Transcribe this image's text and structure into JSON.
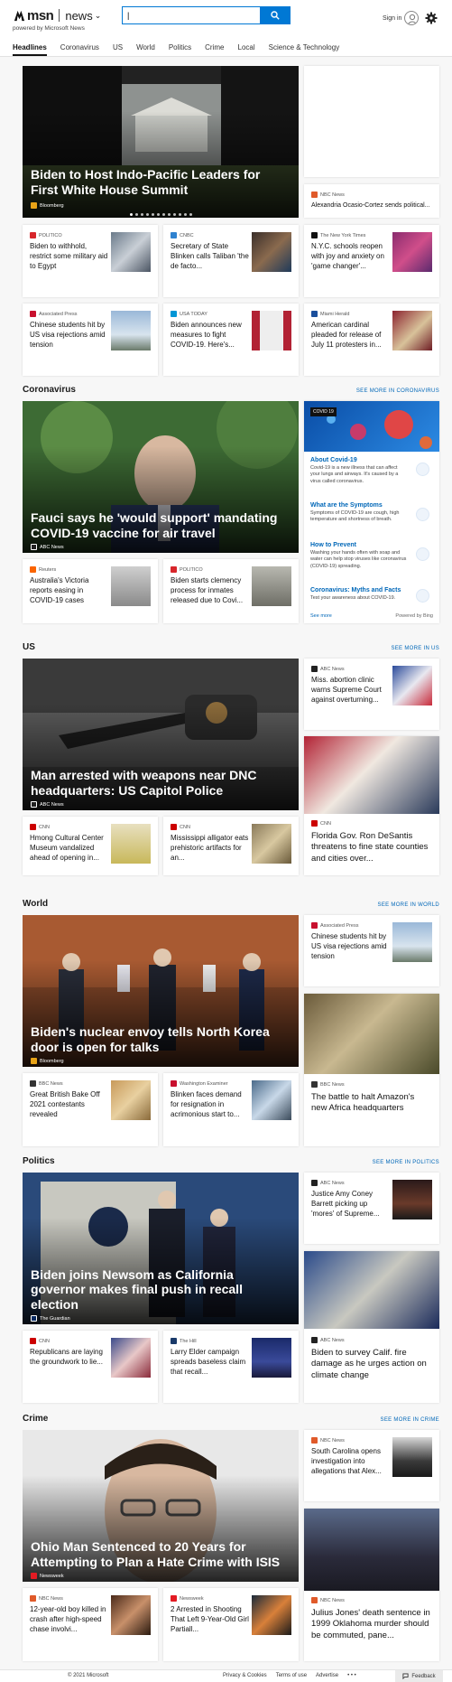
{
  "header": {
    "logo_text": "msn",
    "news_label": "news",
    "powered_by": "powered by Microsoft News",
    "search_value": "|",
    "sign_in": "Sign in"
  },
  "tabs": [
    "Headlines",
    "Coronavirus",
    "US",
    "World",
    "Politics",
    "Crime",
    "Local",
    "Science & Technology"
  ],
  "headlines": {
    "hero": {
      "title": "Biden to Host Indo-Pacific Leaders for First White House Summit",
      "source": "Bloomberg"
    },
    "side1": {
      "source": "NBC News",
      "title": "Alexandria Ocasio-Cortez sends political..."
    },
    "row1": [
      {
        "source": "POLITICO",
        "title": "Biden to withhold, restrict some military aid to Egypt"
      },
      {
        "source": "CNBC",
        "title": "Secretary of State Blinken calls Taliban 'the de facto..."
      },
      {
        "source": "The New York Times",
        "title": "N.Y.C. schools reopen with joy and anxiety on 'game changer'..."
      }
    ],
    "row2": [
      {
        "source": "Associated Press",
        "title": "Chinese students hit by US visa rejections amid tension"
      },
      {
        "source": "USA TODAY",
        "title": "Biden announces new measures to fight COVID-19. Here's..."
      },
      {
        "source": "Miami Herald",
        "title": "American cardinal pleaded for release of July 11 protesters in..."
      }
    ]
  },
  "coronavirus": {
    "title": "Coronavirus",
    "see_more": "SEE MORE IN CORONAVIRUS",
    "hero": {
      "title": "Fauci says he 'would support' mandating COVID-19 vaccine for air travel",
      "source": "ABC News"
    },
    "row": [
      {
        "source": "Reuters",
        "title": "Australia's Victoria reports easing in COVID-19 cases"
      },
      {
        "source": "POLITICO",
        "title": "Biden starts clemency process for inmates released due to Covi..."
      }
    ],
    "panel": {
      "tag": "COVID 19",
      "items": [
        {
          "title": "About Covid-19",
          "desc": "Covid-19 is a new illness that can affect your lungs and airways. It's caused by a virus called coronavirus."
        },
        {
          "title": "What are the Symptoms",
          "desc": "Symptoms of COVID-19 are cough, high temperature and shortness of breath."
        },
        {
          "title": "How to Prevent",
          "desc": "Washing your hands often with soap and water can help stop viruses like coronavirus (COVID-19) spreading."
        },
        {
          "title": "Coronavirus: Myths and Facts",
          "desc": "Test your awareness about COVID-19."
        }
      ],
      "see_more": "See more",
      "powered": "Powered by Bing"
    }
  },
  "us": {
    "title": "US",
    "see_more": "SEE MORE IN US",
    "hero": {
      "title": "Man arrested with weapons near DNC headquarters: US Capitol Police",
      "source": "ABC News"
    },
    "side1": {
      "source": "ABC News",
      "title": "Miss. abortion clinic warns Supreme Court against overturning..."
    },
    "row": [
      {
        "source": "CNN",
        "title": "Hmong Cultural Center Museum vandalized ahead of opening in..."
      },
      {
        "source": "CNN",
        "title": "Mississippi alligator eats prehistoric artifacts for an..."
      }
    ],
    "side2": {
      "source": "CNN",
      "title": "Florida Gov. Ron DeSantis threatens to fine state counties and cities over..."
    }
  },
  "world": {
    "title": "World",
    "see_more": "SEE MORE IN WORLD",
    "hero": {
      "title": "Biden's nuclear envoy tells North Korea door is open for talks",
      "source": "Bloomberg"
    },
    "side1": {
      "source": "Associated Press",
      "title": "Chinese students hit by US visa rejections amid tension"
    },
    "row": [
      {
        "source": "BBC News",
        "title": "Great British Bake Off 2021 contestants revealed"
      },
      {
        "source": "Washington Examiner",
        "title": "Blinken faces demand for resignation in acrimonious start to..."
      }
    ],
    "side2": {
      "source": "BBC News",
      "title": "The battle to halt Amazon's new Africa headquarters"
    }
  },
  "politics": {
    "title": "Politics",
    "see_more": "SEE MORE IN POLITICS",
    "hero": {
      "title": "Biden joins Newsom as California governor makes final push in recall election",
      "source": "The Guardian"
    },
    "side1": {
      "source": "ABC News",
      "title": "Justice Amy Coney Barrett picking up 'mores' of Supreme..."
    },
    "row": [
      {
        "source": "CNN",
        "title": "Republicans are laying the groundwork to lie..."
      },
      {
        "source": "The Hill",
        "title": "Larry Elder campaign spreads baseless claim that recall..."
      }
    ],
    "side2": {
      "source": "ABC News",
      "title": "Biden to survey Calif. fire damage as he urges action on climate change"
    }
  },
  "crime": {
    "title": "Crime",
    "see_more": "SEE MORE IN CRIME",
    "hero": {
      "title": "Ohio Man Sentenced to 20 Years for Attempting to Plan a Hate Crime with ISIS",
      "source": "Newsweek"
    },
    "side1": {
      "source": "NBC News",
      "title": "South Carolina opens investigation into allegations that Alex..."
    },
    "row": [
      {
        "source": "NBC News",
        "title": "12-year-old boy killed in crash after high-speed chase involvi..."
      },
      {
        "source": "Newsweek",
        "title": "2 Arrested in Shooting That Left 9-Year-Old Girl Partiall..."
      }
    ],
    "side2": {
      "source": "NBC News",
      "title": "Julius Jones' death sentence in 1999 Oklahoma murder should be commuted, pane..."
    }
  },
  "footer": {
    "copyright": "© 2021 Microsoft",
    "links": [
      "Privacy & Cookies",
      "Terms of use",
      "Advertise"
    ],
    "more": "• • •",
    "feedback": "Feedback"
  },
  "colors": {
    "accent": "#0078d4",
    "link": "#0067b8"
  }
}
